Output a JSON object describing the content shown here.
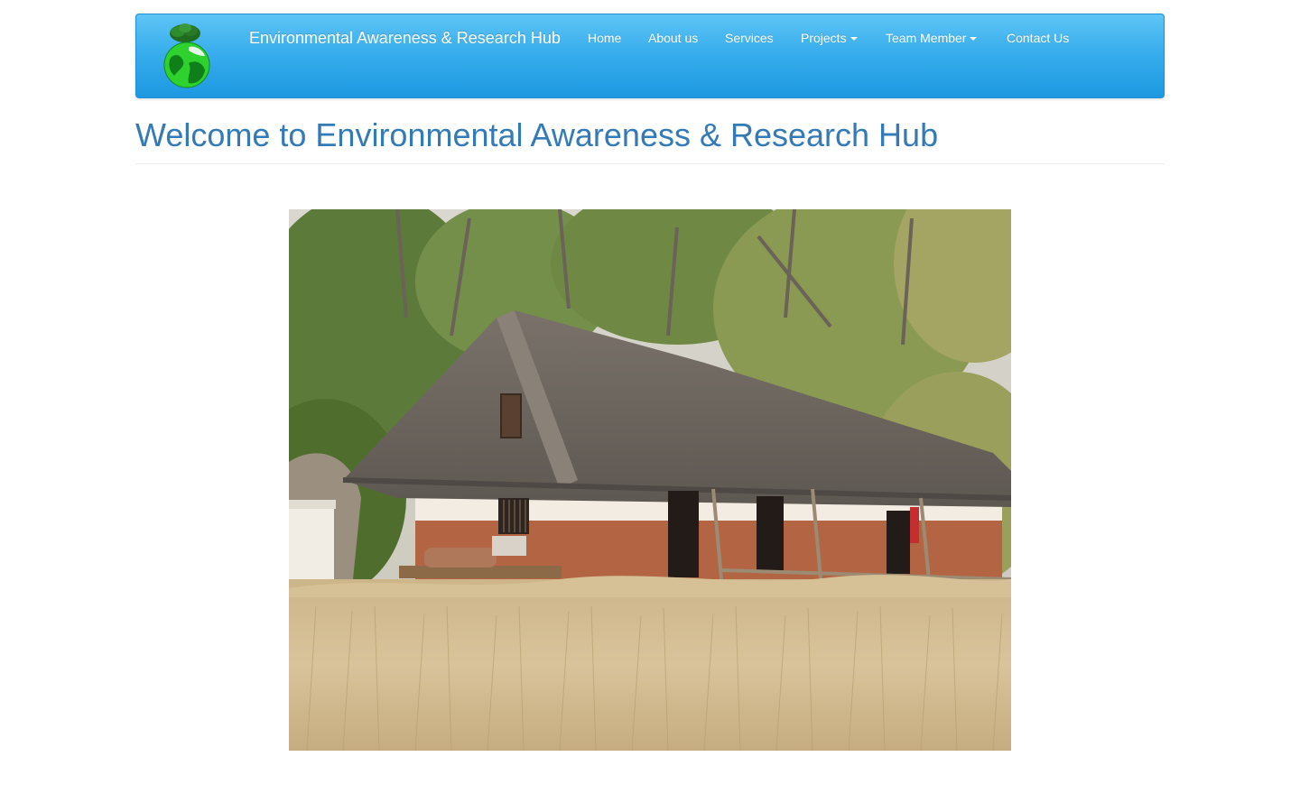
{
  "navbar": {
    "brand": "Environmental Awareness & Research Hub",
    "logo_icon": "earth-tree-logo-icon",
    "items": [
      {
        "label": "Home",
        "dropdown": false
      },
      {
        "label": "About us",
        "dropdown": false
      },
      {
        "label": "Services",
        "dropdown": false
      },
      {
        "label": "Projects",
        "dropdown": true
      },
      {
        "label": "Team Member",
        "dropdown": true
      },
      {
        "label": "Contact Us",
        "dropdown": false
      }
    ],
    "colors": {
      "gradient_top": "#5ec4f5",
      "gradient_bottom": "#1d98e0",
      "text": "#ffffff"
    }
  },
  "main": {
    "heading": "Welcome to Environmental Awareness & Research Hub",
    "heading_color": "#337ab7",
    "hero_image": "thatched-roof-farmhouse-wheat-field-photo"
  }
}
